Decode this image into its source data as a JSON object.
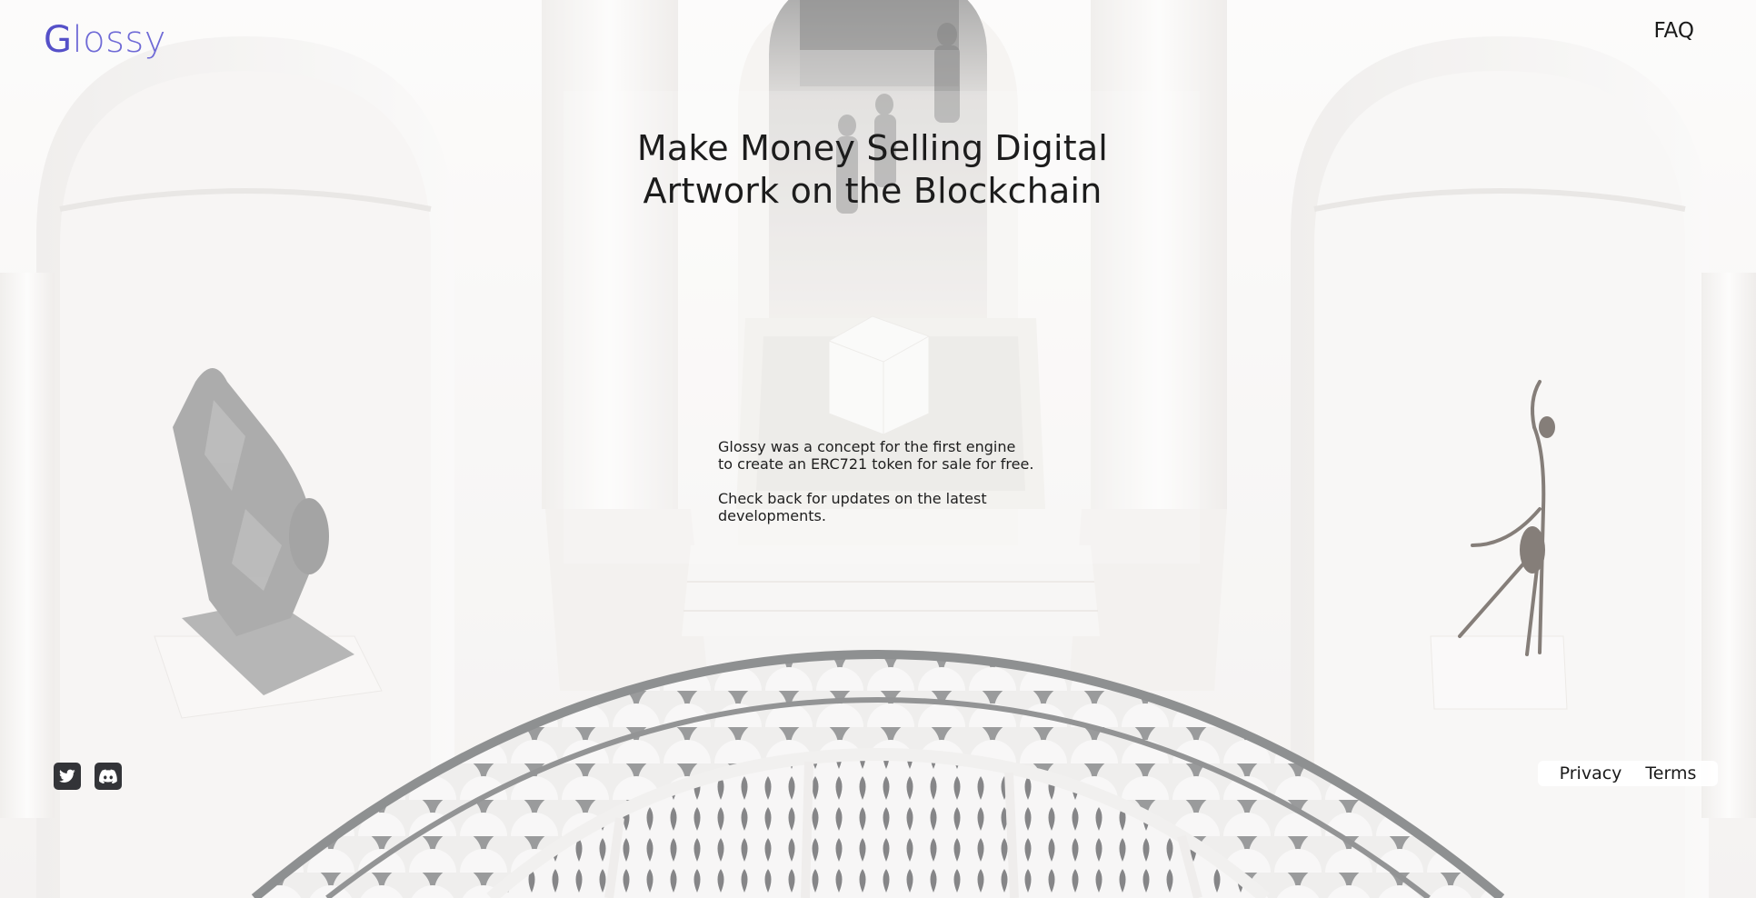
{
  "header": {
    "logo_first_letter": "G",
    "logo_rest": "lossy",
    "faq_label": "FAQ"
  },
  "hero": {
    "title_lines": [
      "Make Money Selling Digital",
      "Artwork on the Blockchain"
    ]
  },
  "intro": {
    "paragraph_1_lines": [
      "Glossy was a concept for the first engine",
      "to create an ERC721 token for sale for free."
    ],
    "paragraph_2_lines": [
      "Check back for updates on the latest",
      "developments."
    ]
  },
  "social": {
    "items": [
      {
        "icon": "twitter-icon"
      },
      {
        "icon": "discord-icon"
      }
    ]
  },
  "footer": {
    "privacy_label": "Privacy",
    "terms_label": "Terms"
  },
  "colors": {
    "logo": "#6f6ad6",
    "text": "#1c1c1c",
    "social_bg": "#333438"
  }
}
